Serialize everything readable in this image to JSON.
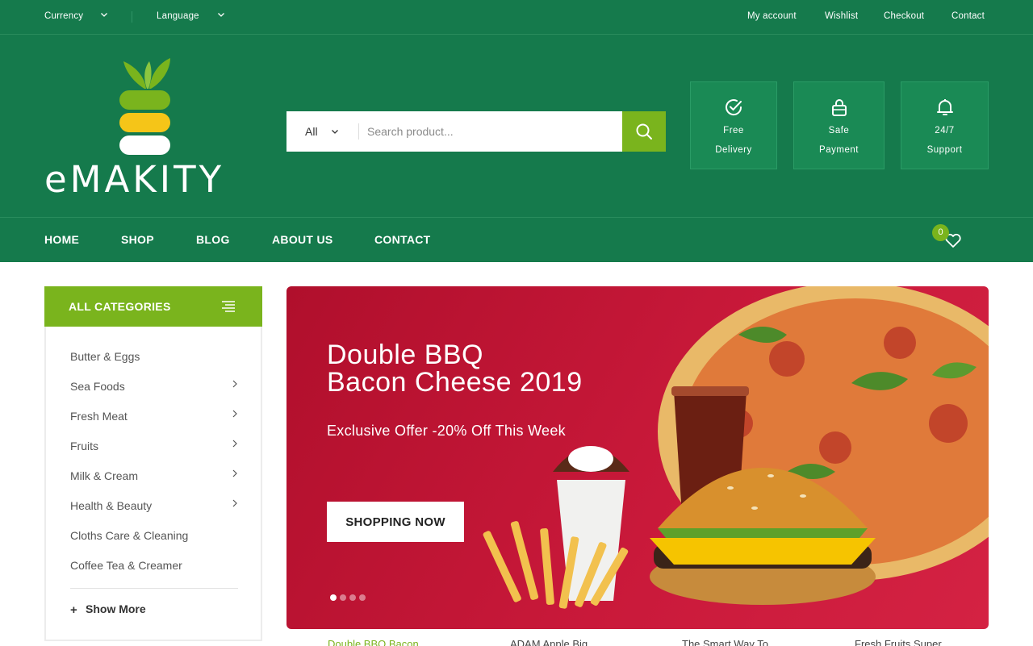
{
  "topbar": {
    "currency_label": "Currency",
    "language_label": "Language",
    "links": [
      "My account",
      "Wishlist",
      "Checkout",
      "Contact"
    ]
  },
  "logo": {
    "text": "eMAKITY"
  },
  "search": {
    "category_value": "All",
    "placeholder": "Search product..."
  },
  "features": [
    {
      "line1": "Free",
      "line2": "Delivery",
      "icon": "check-circle-icon"
    },
    {
      "line1": "Safe",
      "line2": "Payment",
      "icon": "lock-icon"
    },
    {
      "line1": "24/7",
      "line2": "Support",
      "icon": "bell-icon"
    }
  ],
  "nav": {
    "items": [
      "HOME",
      "SHOP",
      "BLOG",
      "ABOUT US",
      "CONTACT"
    ],
    "wishlist_count": "0"
  },
  "categories": {
    "title": "ALL CATEGORIES",
    "items": [
      {
        "label": "Butter & Eggs",
        "has_sub": false
      },
      {
        "label": "Sea Foods",
        "has_sub": true
      },
      {
        "label": "Fresh Meat",
        "has_sub": true
      },
      {
        "label": "Fruits",
        "has_sub": true
      },
      {
        "label": "Milk & Cream",
        "has_sub": true
      },
      {
        "label": "Health & Beauty",
        "has_sub": true
      },
      {
        "label": "Cloths Care & Cleaning",
        "has_sub": false
      },
      {
        "label": "Coffee Tea & Creamer",
        "has_sub": false
      }
    ],
    "show_more": "Show More"
  },
  "hero": {
    "title_line1": "Double BBQ",
    "title_line2": "Bacon Cheese 2019",
    "subtitle": "Exclusive Offer -20% Off This Week",
    "button": "SHOPPING NOW",
    "slide_count": 4,
    "active_slide": 1
  },
  "products": [
    "Double BBQ Bacon",
    "ADAM Apple Big",
    "The Smart Way To",
    "Fresh Fruits Super"
  ],
  "colors": {
    "primary_green": "#157a4c",
    "accent_green": "#7ab41d",
    "hero_red": "#c9193a"
  }
}
